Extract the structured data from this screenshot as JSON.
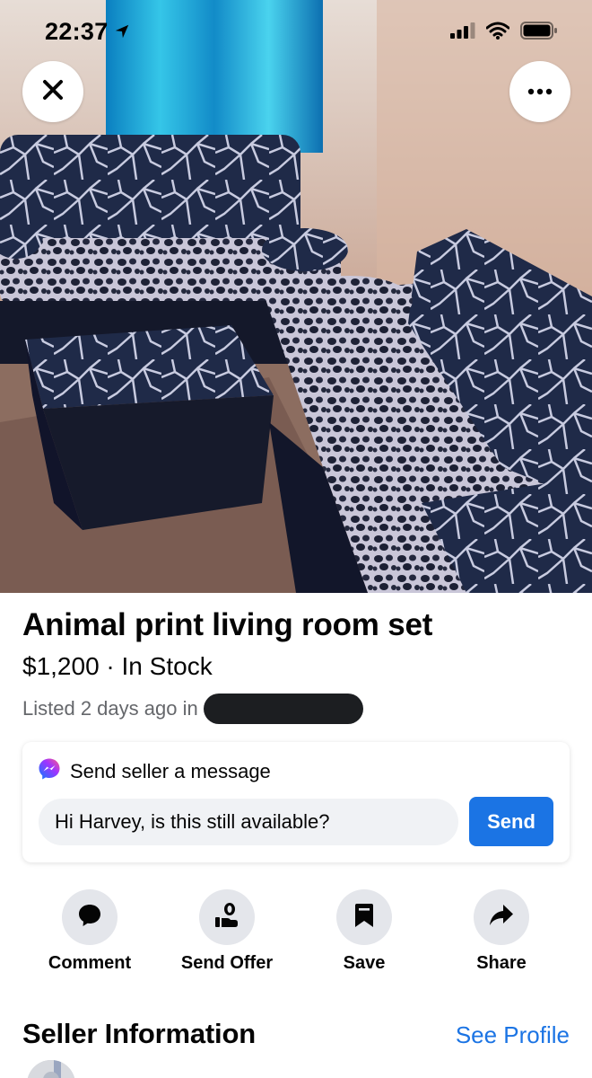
{
  "status_bar": {
    "time": "22:37"
  },
  "listing": {
    "title": "Animal print living room set",
    "price": "$1,200",
    "separator": "·",
    "availability": "In Stock",
    "listed_prefix": "Listed 2 days ago in"
  },
  "message": {
    "header": "Send seller a message",
    "input_value": "Hi Harvey, is this still available?",
    "send_label": "Send"
  },
  "actions": [
    {
      "label": "Comment",
      "icon": "comment-icon"
    },
    {
      "label": "Send Offer",
      "icon": "offer-icon"
    },
    {
      "label": "Save",
      "icon": "bookmark-icon"
    },
    {
      "label": "Share",
      "icon": "share-icon"
    }
  ],
  "seller": {
    "heading": "Seller Information",
    "see_profile": "See Profile"
  },
  "colors": {
    "accent": "#1b74e4",
    "secondary_text": "#65676b",
    "action_circle": "#e4e6eb",
    "input_bg": "#f0f2f5"
  }
}
